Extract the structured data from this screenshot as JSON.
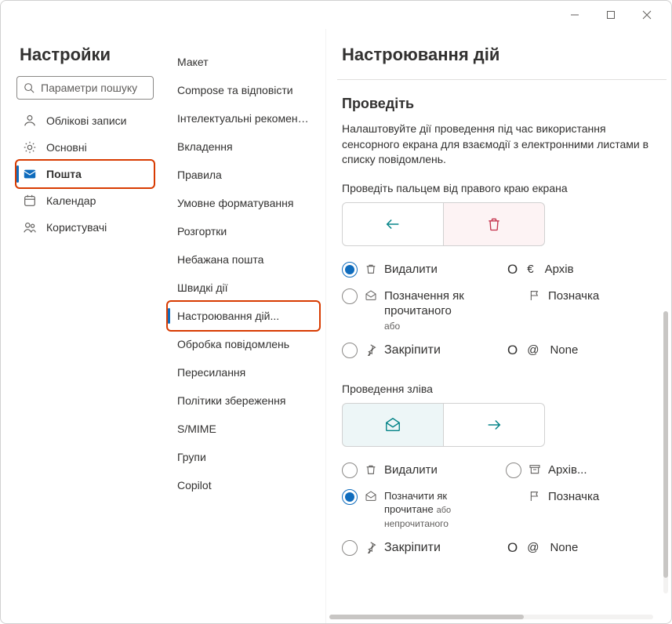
{
  "sidebar": {
    "title": "Настройки",
    "search_placeholder": "Параметри пошуку",
    "items": [
      {
        "label": "Облікові записи"
      },
      {
        "label": "Основні"
      },
      {
        "label": "Пошта"
      },
      {
        "label": "Календар"
      },
      {
        "label": "Користувачі"
      }
    ]
  },
  "submenu": {
    "items": [
      "Макет",
      "Compose та відповісти",
      "Інтелектуальні рекомендації",
      "Вкладення",
      "Правила",
      "Умовне форматування",
      "Розгортки",
      "Небажана пошта",
      "Швидкі дії",
      "Настроювання дій...",
      "Обробка повідомлень",
      "Пересилання",
      "Політики збереження",
      "S/MIME",
      "Групи",
      "Copilot"
    ]
  },
  "main": {
    "title": "Настроювання дій",
    "section_title": "Проведіть",
    "section_desc": "Налаштовуйте дії проведення під час використання сенсорного екрана для взаємодії з електронними листами в списку повідомлень.",
    "right_swipe_label": "Проведіть пальцем від правого краю екрана",
    "left_swipe_label": "Проведення зліва",
    "opts_right": [
      {
        "label": "Видалити"
      },
      {
        "label": "Архів",
        "euro": "€"
      },
      {
        "label": "Позначення як прочитаного",
        "sub": "або"
      },
      {
        "label": "Позначка"
      },
      {
        "label": "Закріпити"
      },
      {
        "label": "None",
        "at": "@"
      }
    ],
    "opts_left": [
      {
        "label": "Видалити"
      },
      {
        "label": "Архів..."
      },
      {
        "label": "Позначити як прочитане",
        "sub": "непрочитаного",
        "or": "або"
      },
      {
        "label": "Позначка"
      },
      {
        "label": "Закріпити"
      },
      {
        "label": "None",
        "at": "@"
      }
    ]
  }
}
